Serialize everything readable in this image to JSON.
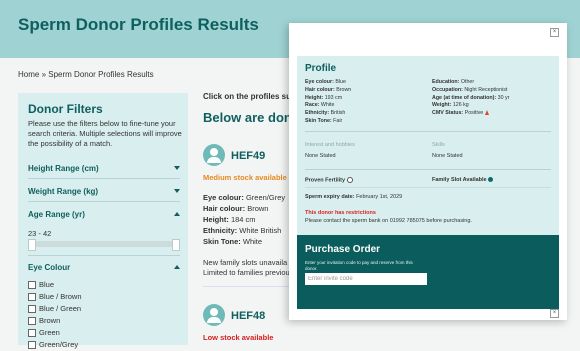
{
  "header": {
    "title": "Sperm Donor Profiles Results"
  },
  "breadcrumb": {
    "home": "Home",
    "sep": "»",
    "current": "Sperm Donor Profiles Results"
  },
  "filters": {
    "title": "Donor Filters",
    "intro": "Please use the filters below to fine-tune your search criteria. Multiple selections will improve the possibility of a match.",
    "height_label": "Height Range (cm)",
    "weight_label": "Weight Range (kg)",
    "age_label": "Age Range (yr)",
    "age_value": "23 - 42",
    "age_range_fraction": [
      0.0,
      1.0
    ],
    "eye_label": "Eye Colour",
    "eye_options": [
      "Blue",
      "Blue / Brown",
      "Blue / Green",
      "Brown",
      "Green",
      "Green/Grey"
    ]
  },
  "results": {
    "prompt": "Click on the profiles sugg",
    "heading": "Below are dono",
    "donors": [
      {
        "code": "HEF49",
        "stock": "Medium stock available",
        "stock_color": "#e58a1f",
        "eye_label": "Eye colour:",
        "eye": "Green/Grey",
        "hair_label": "Hair colour:",
        "hair": "Brown",
        "height_label": "Height:",
        "height": "184 cm",
        "ethnicity_label": "Ethnicity:",
        "ethnicity": "White British",
        "skin_label": "Skin Tone:",
        "skin": "White"
      },
      {
        "code": "HEF48",
        "stock": "Low stock available",
        "stock_color": "#d42020"
      }
    ],
    "note_line1": "New family slots unavaila",
    "note_line2": "Limited to families previou"
  },
  "modal": {
    "close_icon": "×",
    "profile_title": "Profile",
    "left": {
      "eye_label": "Eye colour:",
      "eye": "Blue",
      "hair_label": "Hair colour:",
      "hair": "Brown",
      "height_label": "Height:",
      "height": "193 cm",
      "race_label": "Race:",
      "race": "White",
      "ethnicity_label": "Ethnicity:",
      "ethnicity": "British",
      "skin_label": "Skin Tone:",
      "skin": "Fair"
    },
    "right": {
      "education_label": "Education:",
      "education": "Other",
      "occupation_label": "Occupation:",
      "occupation": "Night Receptionist",
      "age_label": "Age (at time of donation):",
      "age": "30 yr",
      "weight_label": "Weight:",
      "weight": "126 kg",
      "cmv_label": "CMV Status:",
      "cmv": "Positive"
    },
    "interests_label": "Interest and hobbies",
    "interests_value": "None Stated",
    "skills_label": "Skills",
    "skills_value": "None Stated",
    "proven_fertility": "Proven Fertility",
    "family_slot": "Family Slot Available",
    "expiry_label": "Sperm expiry date:",
    "expiry_value": "February 1st, 2029",
    "restriction": "This donor has restrictions",
    "contact": "Please contact the sperm bank on 01992 785075 before purchasing.",
    "purchase_title": "Purchase Order",
    "purchase_text": "Enter your invitation code to pay and reserve from this donor.",
    "invite_placeholder": "Enter invite code",
    "colors": {
      "teal_dark": "#0b5d5d",
      "teal_light": "#d9eeee",
      "header": "#9fd3d3"
    }
  }
}
